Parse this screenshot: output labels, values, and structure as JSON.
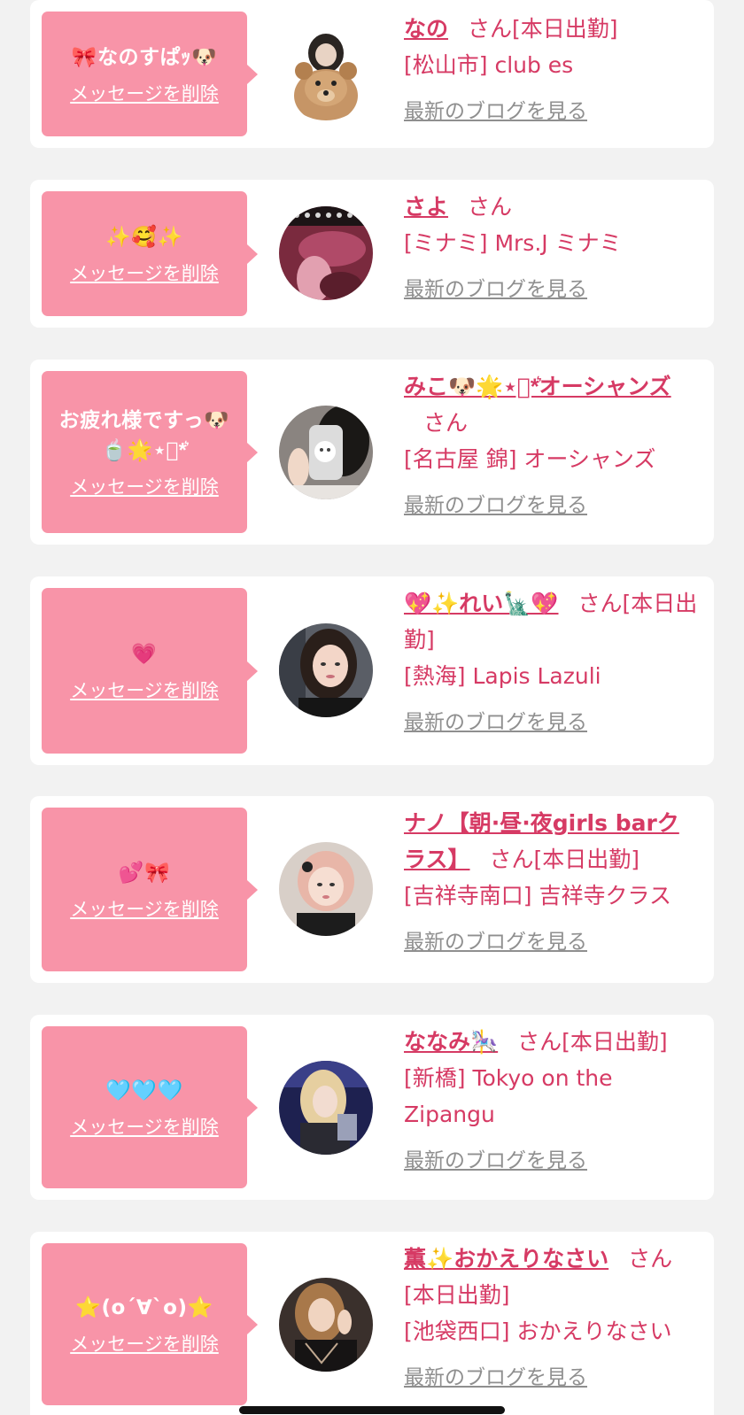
{
  "colors": {
    "page_bg": "#f2f2f2",
    "card_bg": "#ffffff",
    "bubble_bg": "#f894a8",
    "name_text": "#d63a64",
    "blog_link_text": "#8f8f8f"
  },
  "items": [
    {
      "message": "🎀なのすぱｯ🐶",
      "delete_label": "メッセージを削除",
      "name": "なの",
      "honorific": "さん",
      "status": "[本日出勤]",
      "shop": "[松山市] club es",
      "blog_label": "最新のブログを見る",
      "avatar_icon": "teddy-bear-photo"
    },
    {
      "message": "✨🥰✨",
      "delete_label": "メッセージを削除",
      "name": "さよ",
      "honorific": "さん",
      "status": "",
      "shop": "[ミナミ] Mrs.J ミナミ",
      "blog_label": "最新のブログを見る",
      "avatar_icon": "pink-room-photo"
    },
    {
      "message": "お疲れ様ですっ🐶🍵🌟⋆͛*͛",
      "delete_label": "メッセージを削除",
      "name": "みこ🐶🌟⋆͛*͛オーシャンズ",
      "honorific": "さん",
      "status": "",
      "shop": "[名古屋 錦] オーシャンズ",
      "blog_label": "最新のブログを見る",
      "avatar_icon": "mirror-selfie-photo"
    },
    {
      "message": "💗",
      "delete_label": "メッセージを削除",
      "name": "💖✨れい🗽💖",
      "honorific": "さん",
      "status": "[本日出勤]",
      "shop": "[熱海] Lapis Lazuli",
      "blog_label": "最新のブログを見る",
      "avatar_icon": "portrait-photo"
    },
    {
      "message": "💕🎀",
      "delete_label": "メッセージを削除",
      "name": "ナノ【朝·昼·夜girls barクラス】",
      "honorific": "さん",
      "status": "[本日出勤]",
      "shop": "[吉祥寺南口] 吉祥寺クラス",
      "blog_label": "最新のブログを見る",
      "avatar_icon": "pink-hair-portrait-photo"
    },
    {
      "message": "🩵🩵🩵",
      "delete_label": "メッセージを削除",
      "name": "ななみ🎠",
      "honorific": "さん",
      "status": "[本日出勤]",
      "shop": "[新橋] Tokyo on the Zipangu",
      "blog_label": "最新のブログを見る",
      "avatar_icon": "blonde-portrait-photo"
    },
    {
      "message": "⭐(o´∀`o)⭐",
      "delete_label": "メッセージを削除",
      "name": "薫✨おかえりなさい",
      "honorific": "さん",
      "status": "[本日出勤]",
      "shop": "[池袋西口] おかえりなさい",
      "blog_label": "最新のブログを見る",
      "avatar_icon": "dark-dress-portrait-photo"
    }
  ]
}
